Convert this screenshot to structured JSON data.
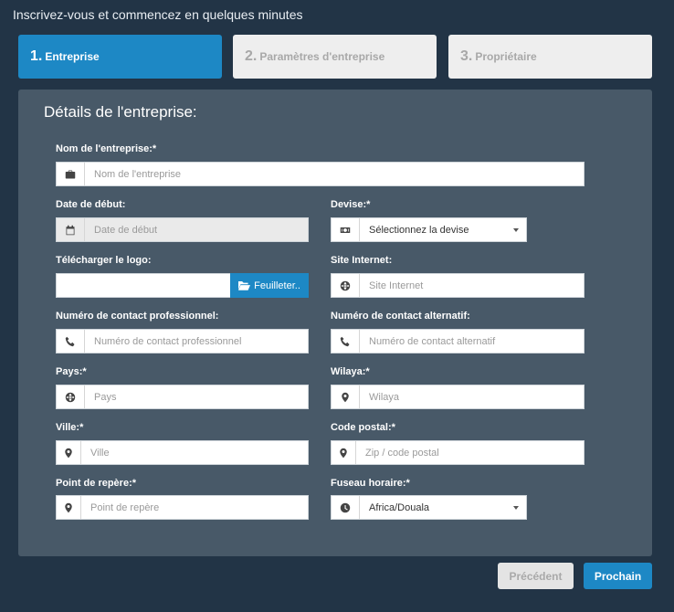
{
  "header": {
    "title": "Inscrivez-vous et commencez en quelques minutes"
  },
  "steps": [
    {
      "number": "1.",
      "label": "Entreprise"
    },
    {
      "number": "2.",
      "label": "Paramètres d'entreprise"
    },
    {
      "number": "3.",
      "label": "Propriétaire"
    }
  ],
  "form": {
    "title": "Détails de l'entreprise:",
    "company_name": {
      "label": "Nom de l'entreprise:*",
      "placeholder": "Nom de l'entreprise",
      "icon": "briefcase-icon"
    },
    "start_date": {
      "label": "Date de début:",
      "placeholder": "Date de début",
      "icon": "calendar-icon"
    },
    "currency": {
      "label": "Devise:*",
      "value": "Sélectionnez la devise",
      "icon": "money-icon"
    },
    "logo": {
      "label": "Télécharger le logo:",
      "button": "Feuilleter..",
      "icon": "folder-open-icon"
    },
    "website": {
      "label": "Site Internet:",
      "placeholder": "Site Internet",
      "icon": "globe-icon"
    },
    "business_contact": {
      "label": "Numéro de contact professionnel:",
      "placeholder": "Numéro de contact professionnel",
      "icon": "phone-icon"
    },
    "alt_contact": {
      "label": "Numéro de contact alternatif:",
      "placeholder": "Numéro de contact alternatif",
      "icon": "phone-icon"
    },
    "country": {
      "label": "Pays:*",
      "placeholder": "Pays",
      "icon": "globe-icon"
    },
    "state": {
      "label": "Wilaya:*",
      "placeholder": "Wilaya",
      "icon": "map-marker-icon"
    },
    "city": {
      "label": "Ville:*",
      "placeholder": "Ville",
      "icon": "map-marker-icon"
    },
    "zip": {
      "label": "Code postal:*",
      "placeholder": "Zip / code postal",
      "icon": "map-marker-icon"
    },
    "landmark": {
      "label": "Point de repère:*",
      "placeholder": "Point de repère",
      "icon": "map-marker-icon"
    },
    "timezone": {
      "label": "Fuseau horaire:*",
      "value": "Africa/Douala",
      "icon": "clock-icon"
    }
  },
  "footer": {
    "prev": "Précédent",
    "next": "Prochain"
  },
  "colors": {
    "accent": "#1d88c5",
    "background": "#223446",
    "panel": "#485968"
  }
}
